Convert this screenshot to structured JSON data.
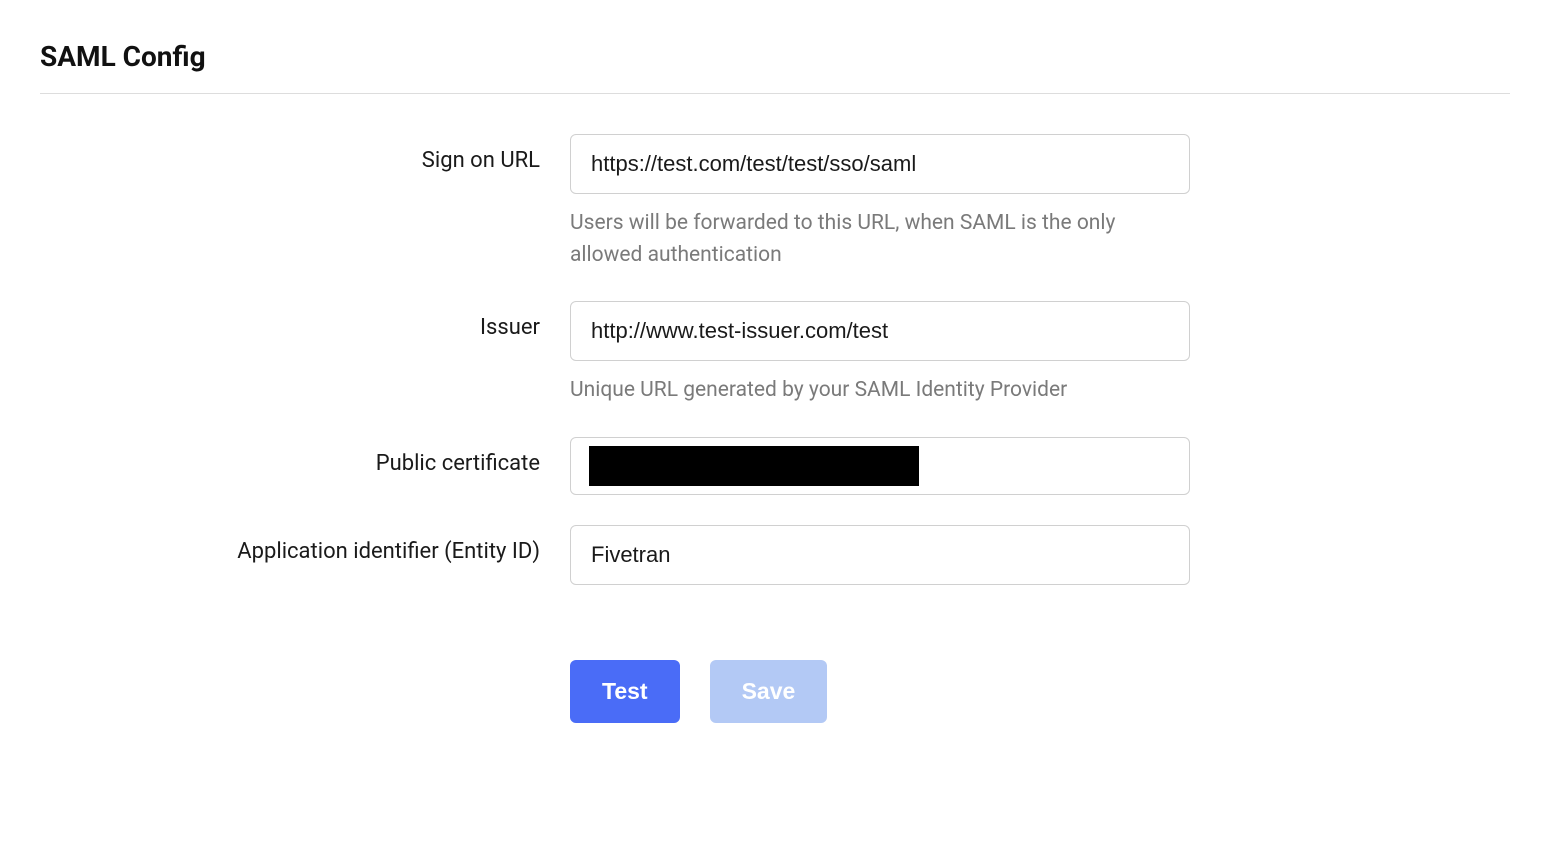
{
  "section": {
    "title": "SAML Config"
  },
  "fields": {
    "signOnUrl": {
      "label": "Sign on URL",
      "value": "https://test.com/test/test/sso/saml",
      "help": "Users will be forwarded to this URL, when SAML is the only allowed authentication"
    },
    "issuer": {
      "label": "Issuer",
      "value": "http://www.test-issuer.com/test",
      "help": "Unique URL generated by your SAML Identity Provider"
    },
    "publicCertificate": {
      "label": "Public certificate"
    },
    "entityId": {
      "label": "Application identifier (Entity ID)",
      "value": "Fivetran"
    }
  },
  "buttons": {
    "test": "Test",
    "save": "Save"
  }
}
